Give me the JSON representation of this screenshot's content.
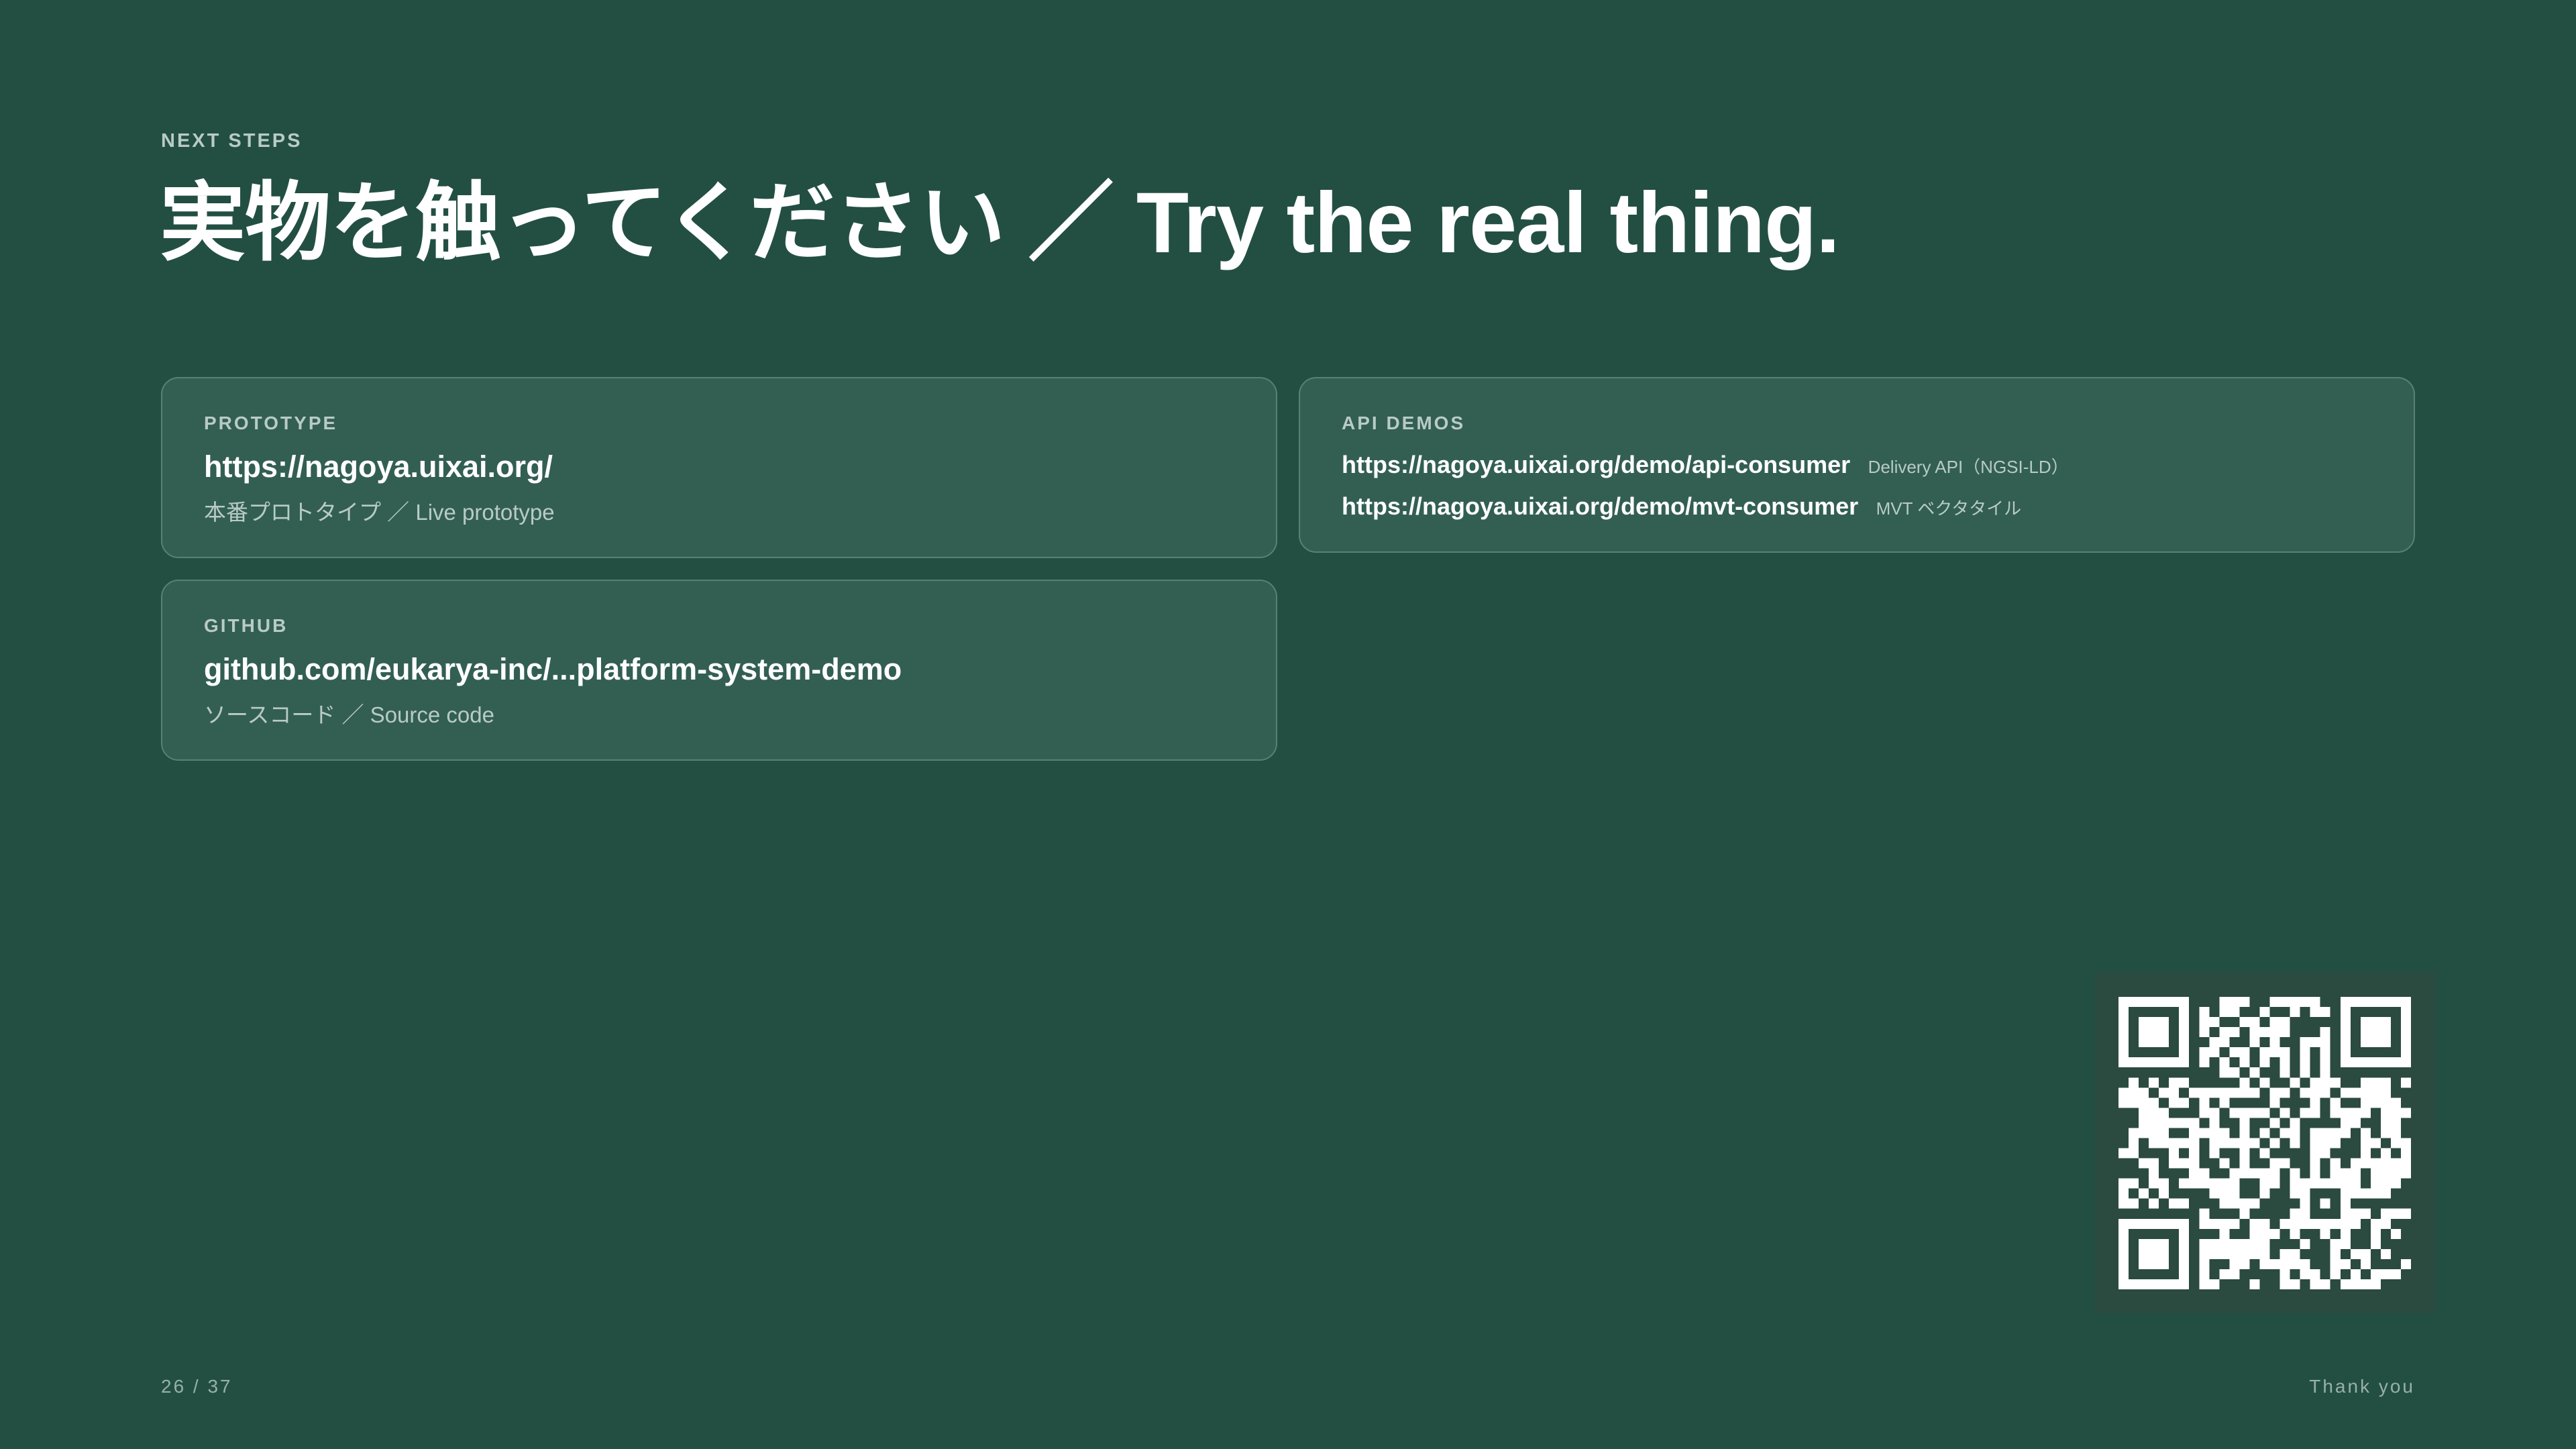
{
  "header": {
    "eyebrow": "NEXT STEPS",
    "title": "実物を触ってください ／ Try the real thing."
  },
  "cards": {
    "prototype": {
      "label": "PROTOTYPE",
      "url": "https://nagoya.uixai.org/",
      "caption": "本番プロトタイプ ／ Live prototype"
    },
    "github": {
      "label": "GITHUB",
      "url": "github.com/eukarya-inc/...platform-system-demo",
      "caption": "ソースコード ／ Source code"
    },
    "api_demos": {
      "label": "API DEMOS",
      "links": [
        {
          "url": "https://nagoya.uixai.org/demo/api-consumer",
          "note": "Delivery API（NGSI-LD）"
        },
        {
          "url": "https://nagoya.uixai.org/demo/mvt-consumer",
          "note": "MVT ベクタタイル"
        }
      ]
    }
  },
  "qr": {
    "icon": "qr-code-icon",
    "background": "#2b4a40",
    "foreground": "#ffffff"
  },
  "footer": {
    "page": "26 / 37",
    "closing": "Thank you"
  },
  "colors": {
    "background": "#234f43",
    "card": "#335f53",
    "card_border": "#5a8075",
    "muted_text": "#b9cbc4"
  }
}
